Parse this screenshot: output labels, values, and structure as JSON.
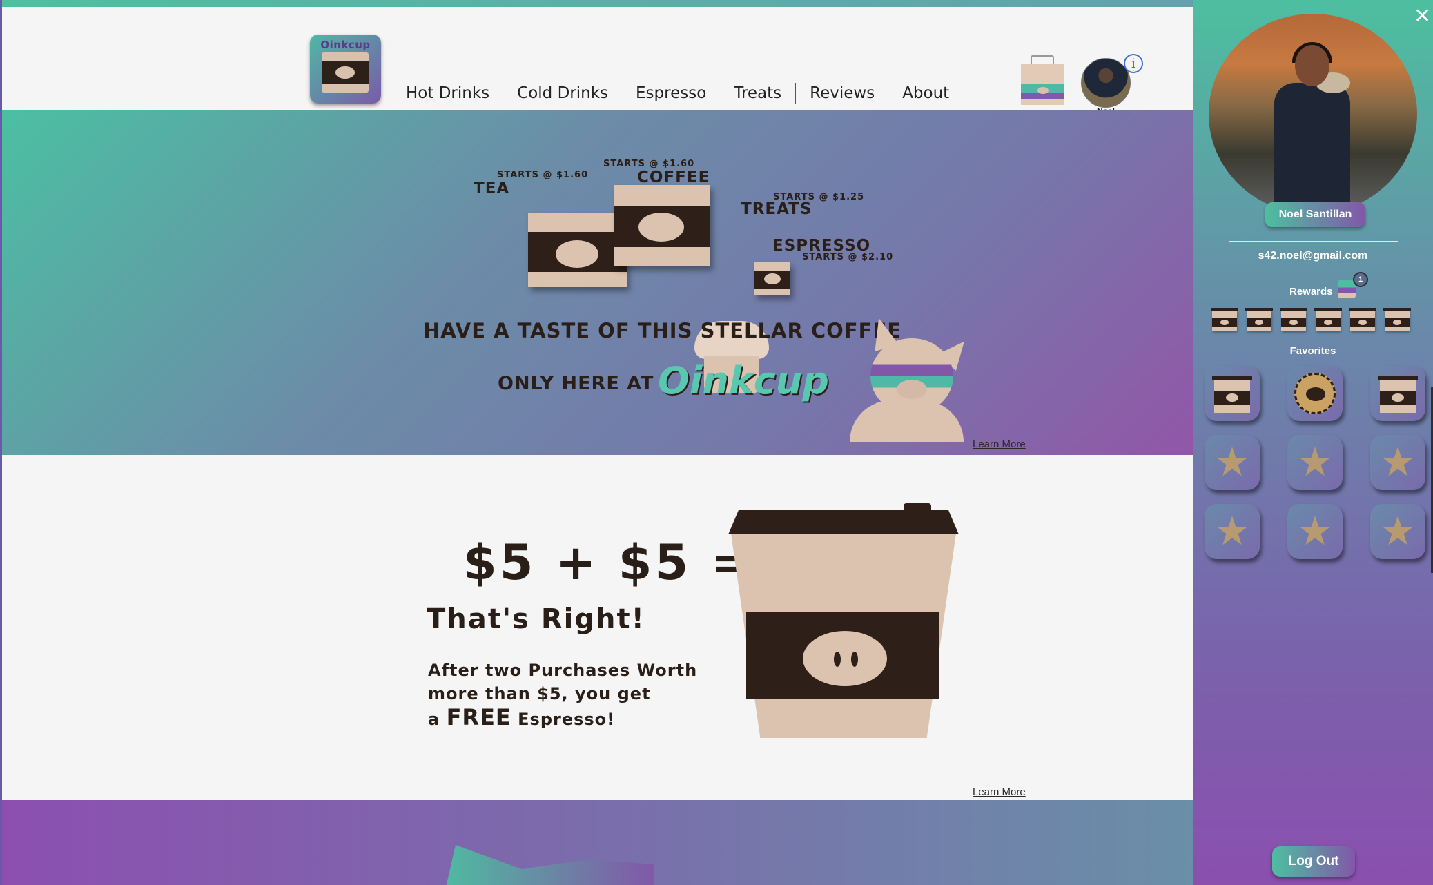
{
  "header": {
    "logo_text": "Oinkcup",
    "nav": [
      "Hot Drinks",
      "Cold Drinks",
      "Espresso",
      "Treats",
      "Reviews",
      "About"
    ],
    "user_short_name": "Noel",
    "info_glyph": "i"
  },
  "hero": {
    "tea_price": "Starts @ $1.60",
    "tea_label": "Tea",
    "coffee_price": "Starts @ $1.60",
    "coffee_label": "Coffee",
    "treats_price": "Starts @ $1.25",
    "treats_label": "Treats",
    "espresso_label": "Espresso",
    "espresso_price": "Starts @ $2.10",
    "tagline_line1": "Have a taste of this stellar coffee",
    "tagline_line2": "only here at",
    "brand": "Oinkcup",
    "learn_more": "Learn More"
  },
  "promo": {
    "equation": "$5 + $5 =",
    "heading": "That's Right!",
    "body_line1": "After two Purchases Worth",
    "body_line2": "more than $5, you get",
    "body_line3_prefix": "a",
    "body_line3_free": "FREE",
    "body_line3_suffix": "Espresso!",
    "learn_more": "Learn More"
  },
  "sidebar": {
    "close_glyph": "✕",
    "name": "Noel Santillan",
    "email": "s42.noel@gmail.com",
    "rewards_label": "Rewards",
    "rewards_count": "1",
    "reward_slots": 6,
    "favorites_label": "Favorites",
    "favorites": [
      "coffee-cup",
      "pig-cookie",
      "coffee-cup",
      "empty",
      "empty",
      "empty",
      "empty",
      "empty",
      "empty"
    ],
    "logout_label": "Log Out"
  },
  "colors": {
    "teal": "#4dbfa0",
    "purple": "#8257a8",
    "cup_brown": "#2e2019",
    "cup_tan": "#dcc3b0"
  }
}
